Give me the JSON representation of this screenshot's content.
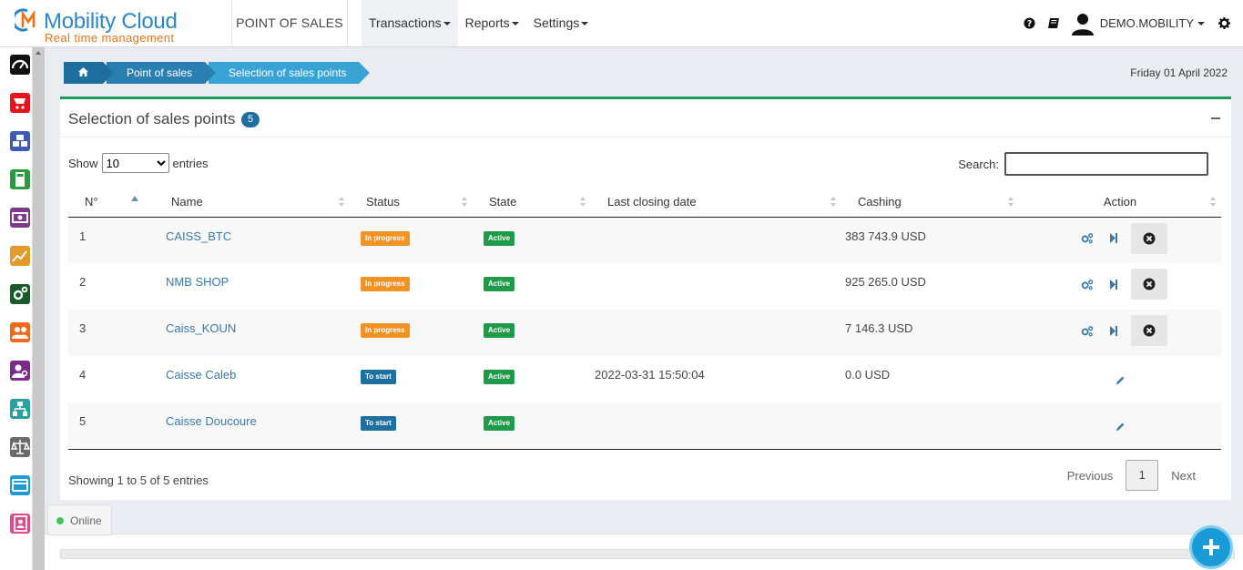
{
  "logo": {
    "brand": "Mobility Cloud",
    "tagline": "Real time management"
  },
  "module_title": "POINT OF SALES",
  "menu": [
    {
      "label": "Transactions",
      "active": true
    },
    {
      "label": "Reports",
      "active": false
    },
    {
      "label": "Settings",
      "active": false
    }
  ],
  "user": {
    "name": "DEMO.MOBILITY"
  },
  "sidebar_icons": [
    {
      "name": "dashboard-icon",
      "color": "#111111"
    },
    {
      "name": "cart-icon",
      "color": "#e8141b"
    },
    {
      "name": "cubes-icon",
      "color": "#3d5ab8"
    },
    {
      "name": "calculator-icon",
      "color": "#2a9a3c"
    },
    {
      "name": "money-icon",
      "color": "#7b3b8a"
    },
    {
      "name": "chart-icon",
      "color": "#e39a2a"
    },
    {
      "name": "gears-icon",
      "color": "#1a5a2a"
    },
    {
      "name": "users-icon",
      "color": "#f06a1a"
    },
    {
      "name": "user-search-icon",
      "color": "#7b2b8a"
    },
    {
      "name": "sitemap-icon",
      "color": "#2aa0a0"
    },
    {
      "name": "balance-icon",
      "color": "#6a6a6a"
    },
    {
      "name": "card-icon",
      "color": "#1e9ad6"
    },
    {
      "name": "contacts-icon",
      "color": "#e04a8a"
    }
  ],
  "breadcrumb": {
    "level1": "Point of sales",
    "level2": "Selection of sales points"
  },
  "date": "Friday 01 April 2022",
  "panel": {
    "title": "Selection of sales points",
    "count": "5"
  },
  "controls": {
    "show_label": "Show",
    "entries_label": "entries",
    "page_size": "10",
    "search_label": "Search:",
    "search_value": ""
  },
  "columns": [
    "N°",
    "Name",
    "Status",
    "State",
    "Last closing date",
    "Cashing",
    "Action"
  ],
  "rows": [
    {
      "n": "1",
      "name": "CAISS_BTC",
      "status": "In progress",
      "state": "Active",
      "last_closing": "",
      "cashing": "383 743.9 USD",
      "action": "full"
    },
    {
      "n": "2",
      "name": "NMB SHOP",
      "status": "In progress",
      "state": "Active",
      "last_closing": "",
      "cashing": "925 265.0 USD",
      "action": "full"
    },
    {
      "n": "3",
      "name": "Caiss_KOUN",
      "status": "In progress",
      "state": "Active",
      "last_closing": "",
      "cashing": "7 146.3 USD",
      "action": "full"
    },
    {
      "n": "4",
      "name": "Caisse Caleb",
      "status": "To start",
      "state": "Active",
      "last_closing": "2022-03-31 15:50:04",
      "cashing": "0.0 USD",
      "action": "edit"
    },
    {
      "n": "5",
      "name": "Caisse Doucoure",
      "status": "To start",
      "state": "Active",
      "last_closing": "",
      "cashing": "",
      "action": "edit"
    }
  ],
  "footer": {
    "info": "Showing 1 to 5 of 5 entries",
    "previous": "Previous",
    "current_page": "1",
    "next": "Next"
  },
  "online_label": "Online",
  "colors": {
    "accent_green": "#1e9a5a",
    "primary_blue": "#1f6f9e",
    "in_progress": "#f39224",
    "active": "#1e9a4a"
  }
}
